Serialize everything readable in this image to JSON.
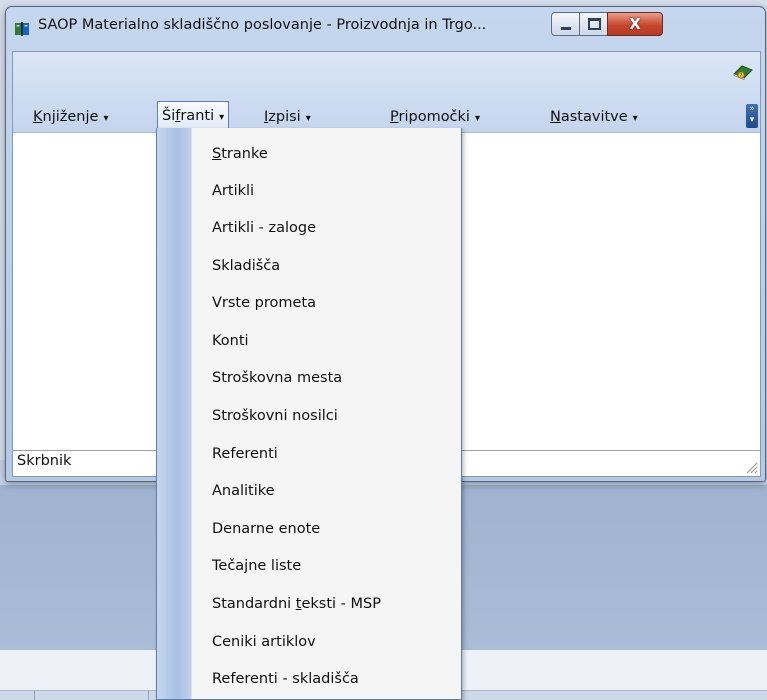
{
  "window": {
    "title": "SAOP  Materialno skladiščno poslovanje - Proizvodnja in Trgo...",
    "close_glyph": "X"
  },
  "menubar": {
    "items": [
      {
        "label_pre": "",
        "mnemonic": "K",
        "label_post": "njiženje"
      },
      {
        "label_pre": "Ši",
        "mnemonic": "f",
        "label_post": "ranti"
      },
      {
        "label_pre": "",
        "mnemonic": "I",
        "label_post": "zpisi"
      },
      {
        "label_pre": "",
        "mnemonic": "P",
        "label_post": "ripomočki"
      },
      {
        "label_pre": "",
        "mnemonic": "N",
        "label_post": "astavitve"
      }
    ],
    "caret": "▾",
    "overflow_glyph": "»"
  },
  "status": {
    "text": "Skrbnik"
  },
  "dropdown": {
    "items": [
      {
        "label_pre": "",
        "mnemonic": "S",
        "label_post": "tranke"
      },
      {
        "label_pre": "Artikli",
        "mnemonic": "",
        "label_post": ""
      },
      {
        "label_pre": "Artikli - zaloge",
        "mnemonic": "",
        "label_post": ""
      },
      {
        "label_pre": "Skladišča",
        "mnemonic": "",
        "label_post": ""
      },
      {
        "label_pre": "Vrste prometa",
        "mnemonic": "",
        "label_post": ""
      },
      {
        "label_pre": "Konti",
        "mnemonic": "",
        "label_post": ""
      },
      {
        "label_pre": "Stroškovna mesta",
        "mnemonic": "",
        "label_post": ""
      },
      {
        "label_pre": "Stroškovni nosilci",
        "mnemonic": "",
        "label_post": ""
      },
      {
        "label_pre": "Referenti",
        "mnemonic": "",
        "label_post": ""
      },
      {
        "label_pre": "Analitike",
        "mnemonic": "",
        "label_post": ""
      },
      {
        "label_pre": "Denarne enote",
        "mnemonic": "",
        "label_post": ""
      },
      {
        "label_pre": "Tečajne liste",
        "mnemonic": "",
        "label_post": ""
      },
      {
        "label_pre": "Standardni ",
        "mnemonic": "t",
        "label_post": "eksti - MSP"
      },
      {
        "label_pre": "Ceniki artiklov",
        "mnemonic": "",
        "label_post": ""
      },
      {
        "label_pre": "Referenti - skladišča",
        "mnemonic": "",
        "label_post": ""
      }
    ]
  },
  "icons": {
    "app": "app-book-icon",
    "help": "help-book-icon",
    "minimize": "minimize-icon",
    "maximize": "maximize-icon",
    "close": "close-icon"
  },
  "colors": {
    "menu_highlight_border": "#5a7fb0",
    "gutter": "#a9c0e3",
    "close_button": "#c8472e"
  }
}
